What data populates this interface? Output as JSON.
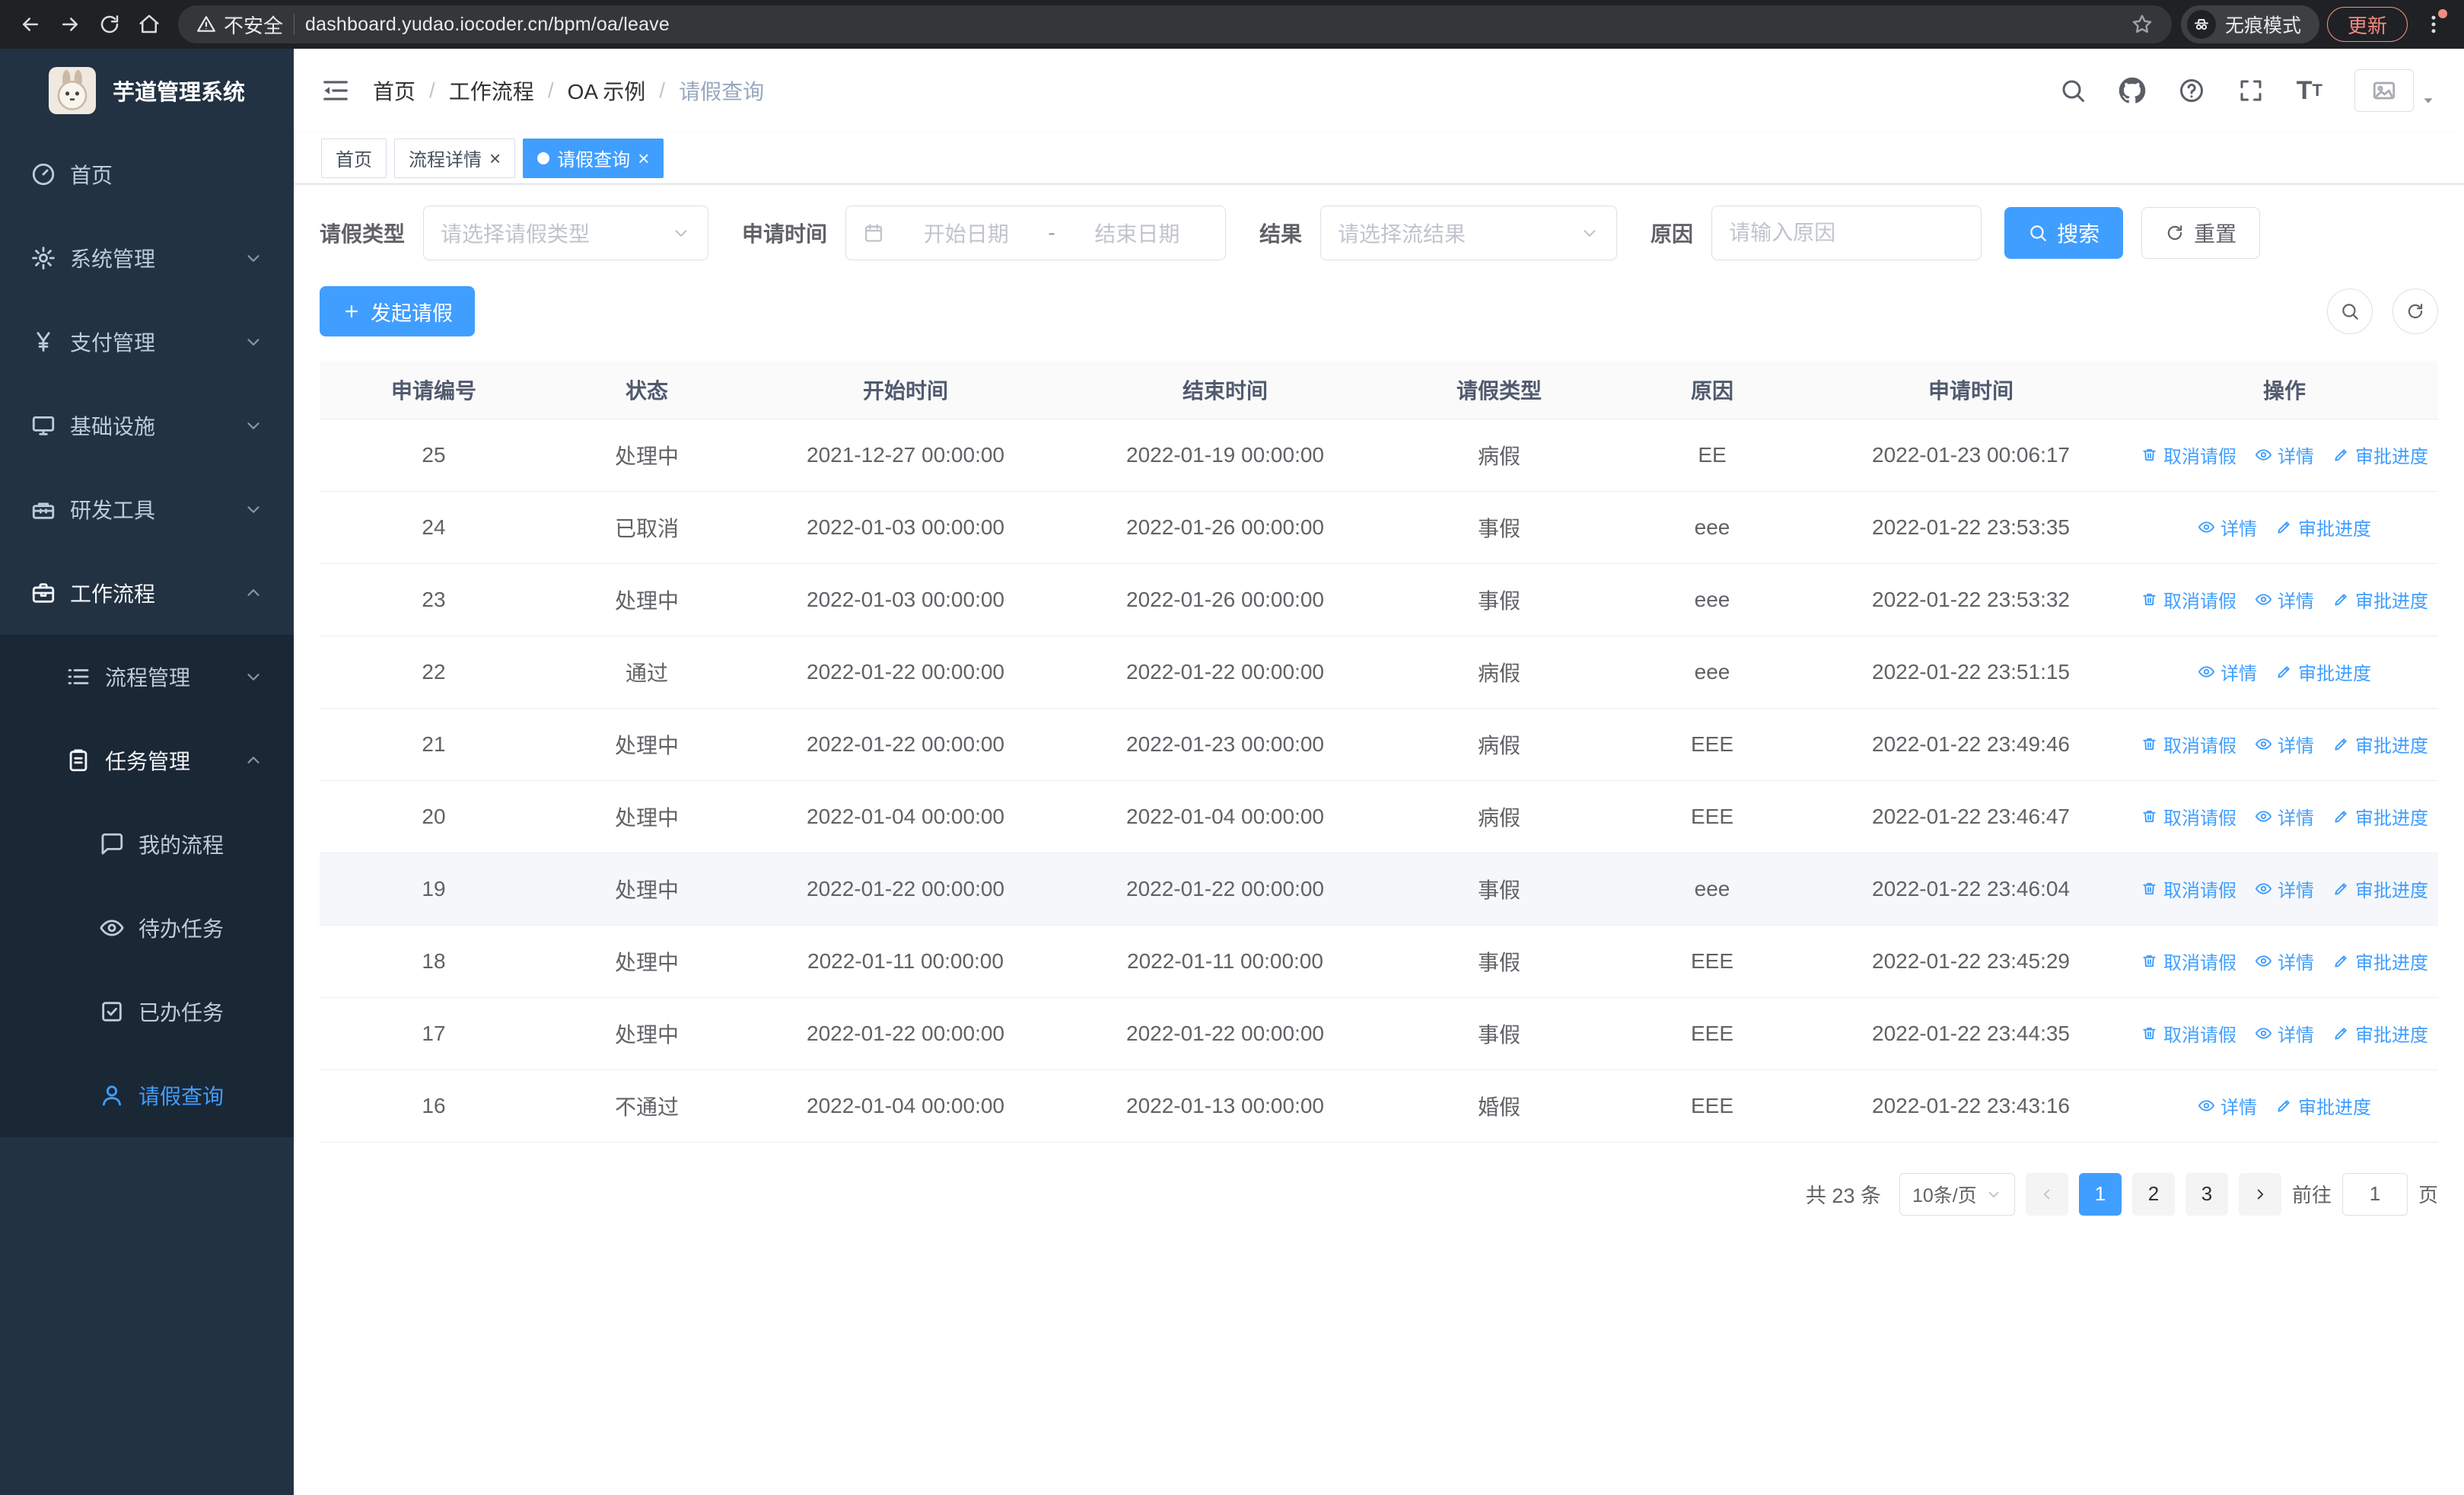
{
  "browser": {
    "security_warning": "不安全",
    "url": "dashboard.yudao.iocoder.cn/bpm/oa/leave",
    "incognito_label": "无痕模式",
    "update_label": "更新"
  },
  "sidebar": {
    "logo_title": "芋道管理系统",
    "items": [
      {
        "key": "home",
        "label": "首页",
        "icon": "dashboard-icon",
        "level": 1
      },
      {
        "key": "system-mgmt",
        "label": "系统管理",
        "icon": "gear-icon",
        "level": 1,
        "chevron": "down"
      },
      {
        "key": "payment-mgmt",
        "label": "支付管理",
        "icon": "yen-icon",
        "level": 1,
        "chevron": "down"
      },
      {
        "key": "infrastructure",
        "label": "基础设施",
        "icon": "monitor-icon",
        "level": 1,
        "chevron": "down"
      },
      {
        "key": "dev-tools",
        "label": "研发工具",
        "icon": "toolbox-icon",
        "level": 1,
        "chevron": "down"
      },
      {
        "key": "workflow",
        "label": "工作流程",
        "icon": "briefcase-icon",
        "level": 1,
        "chevron": "up",
        "open": true
      },
      {
        "key": "process-mgmt",
        "label": "流程管理",
        "icon": "list-icon",
        "level": 2,
        "chevron": "down",
        "sub": true
      },
      {
        "key": "task-mgmt",
        "label": "任务管理",
        "icon": "clipboard-icon",
        "level": 2,
        "chevron": "up",
        "open": true,
        "sub": true
      },
      {
        "key": "my-process",
        "label": "我的流程",
        "icon": "chat-icon",
        "level": 3,
        "sub": true
      },
      {
        "key": "todo-tasks",
        "label": "待办任务",
        "icon": "eye-icon",
        "level": 3,
        "sub": true
      },
      {
        "key": "done-tasks",
        "label": "已办任务",
        "icon": "check-square-icon",
        "level": 3,
        "sub": true
      },
      {
        "key": "leave-query",
        "label": "请假查询",
        "icon": "user-icon",
        "level": 3,
        "sub": true,
        "active": true
      }
    ]
  },
  "header": {
    "breadcrumb": [
      "首页",
      "工作流程",
      "OA 示例",
      "请假查询"
    ]
  },
  "tabs": [
    {
      "key": "home",
      "label": "首页",
      "closable": false,
      "active": false
    },
    {
      "key": "process-detail",
      "label": "流程详情",
      "closable": true,
      "active": false
    },
    {
      "key": "leave-query",
      "label": "请假查询",
      "closable": true,
      "active": true
    }
  ],
  "filters": {
    "leave_type": {
      "label": "请假类型",
      "placeholder": "请选择请假类型"
    },
    "apply_time": {
      "label": "申请时间",
      "start_placeholder": "开始日期",
      "separator": "-",
      "end_placeholder": "结束日期"
    },
    "result": {
      "label": "结果",
      "placeholder": "请选择流结果"
    },
    "reason": {
      "label": "原因",
      "placeholder": "请输入原因"
    },
    "search_label": "搜索",
    "reset_label": "重置"
  },
  "toolbar": {
    "create_label": "发起请假"
  },
  "table": {
    "columns": [
      "申请编号",
      "状态",
      "开始时间",
      "结束时间",
      "请假类型",
      "原因",
      "申请时间",
      "操作"
    ],
    "action_labels": {
      "cancel": "取消请假",
      "detail": "详情",
      "progress": "审批进度"
    },
    "rows": [
      {
        "id": "25",
        "status": "处理中",
        "start": "2021-12-27 00:00:00",
        "end": "2022-01-19 00:00:00",
        "type": "病假",
        "reason": "EE",
        "applied": "2022-01-23 00:06:17",
        "can_cancel": true
      },
      {
        "id": "24",
        "status": "已取消",
        "start": "2022-01-03 00:00:00",
        "end": "2022-01-26 00:00:00",
        "type": "事假",
        "reason": "eee",
        "applied": "2022-01-22 23:53:35",
        "can_cancel": false
      },
      {
        "id": "23",
        "status": "处理中",
        "start": "2022-01-03 00:00:00",
        "end": "2022-01-26 00:00:00",
        "type": "事假",
        "reason": "eee",
        "applied": "2022-01-22 23:53:32",
        "can_cancel": true
      },
      {
        "id": "22",
        "status": "通过",
        "start": "2022-01-22 00:00:00",
        "end": "2022-01-22 00:00:00",
        "type": "病假",
        "reason": "eee",
        "applied": "2022-01-22 23:51:15",
        "can_cancel": false
      },
      {
        "id": "21",
        "status": "处理中",
        "start": "2022-01-22 00:00:00",
        "end": "2022-01-23 00:00:00",
        "type": "病假",
        "reason": "EEE",
        "applied": "2022-01-22 23:49:46",
        "can_cancel": true
      },
      {
        "id": "20",
        "status": "处理中",
        "start": "2022-01-04 00:00:00",
        "end": "2022-01-04 00:00:00",
        "type": "病假",
        "reason": "EEE",
        "applied": "2022-01-22 23:46:47",
        "can_cancel": true
      },
      {
        "id": "19",
        "status": "处理中",
        "start": "2022-01-22 00:00:00",
        "end": "2022-01-22 00:00:00",
        "type": "事假",
        "reason": "eee",
        "applied": "2022-01-22 23:46:04",
        "can_cancel": true,
        "highlighted": true
      },
      {
        "id": "18",
        "status": "处理中",
        "start": "2022-01-11 00:00:00",
        "end": "2022-01-11 00:00:00",
        "type": "事假",
        "reason": "EEE",
        "applied": "2022-01-22 23:45:29",
        "can_cancel": true
      },
      {
        "id": "17",
        "status": "处理中",
        "start": "2022-01-22 00:00:00",
        "end": "2022-01-22 00:00:00",
        "type": "事假",
        "reason": "EEE",
        "applied": "2022-01-22 23:44:35",
        "can_cancel": true
      },
      {
        "id": "16",
        "status": "不通过",
        "start": "2022-01-04 00:00:00",
        "end": "2022-01-13 00:00:00",
        "type": "婚假",
        "reason": "EEE",
        "applied": "2022-01-22 23:43:16",
        "can_cancel": false
      }
    ]
  },
  "pagination": {
    "total_text": "共 23 条",
    "page_size_label": "10条/页",
    "pages": [
      "1",
      "2",
      "3"
    ],
    "active_page": "1",
    "prev_disabled": true,
    "goto_label": "前往",
    "goto_value": "1",
    "unit_label": "页"
  }
}
